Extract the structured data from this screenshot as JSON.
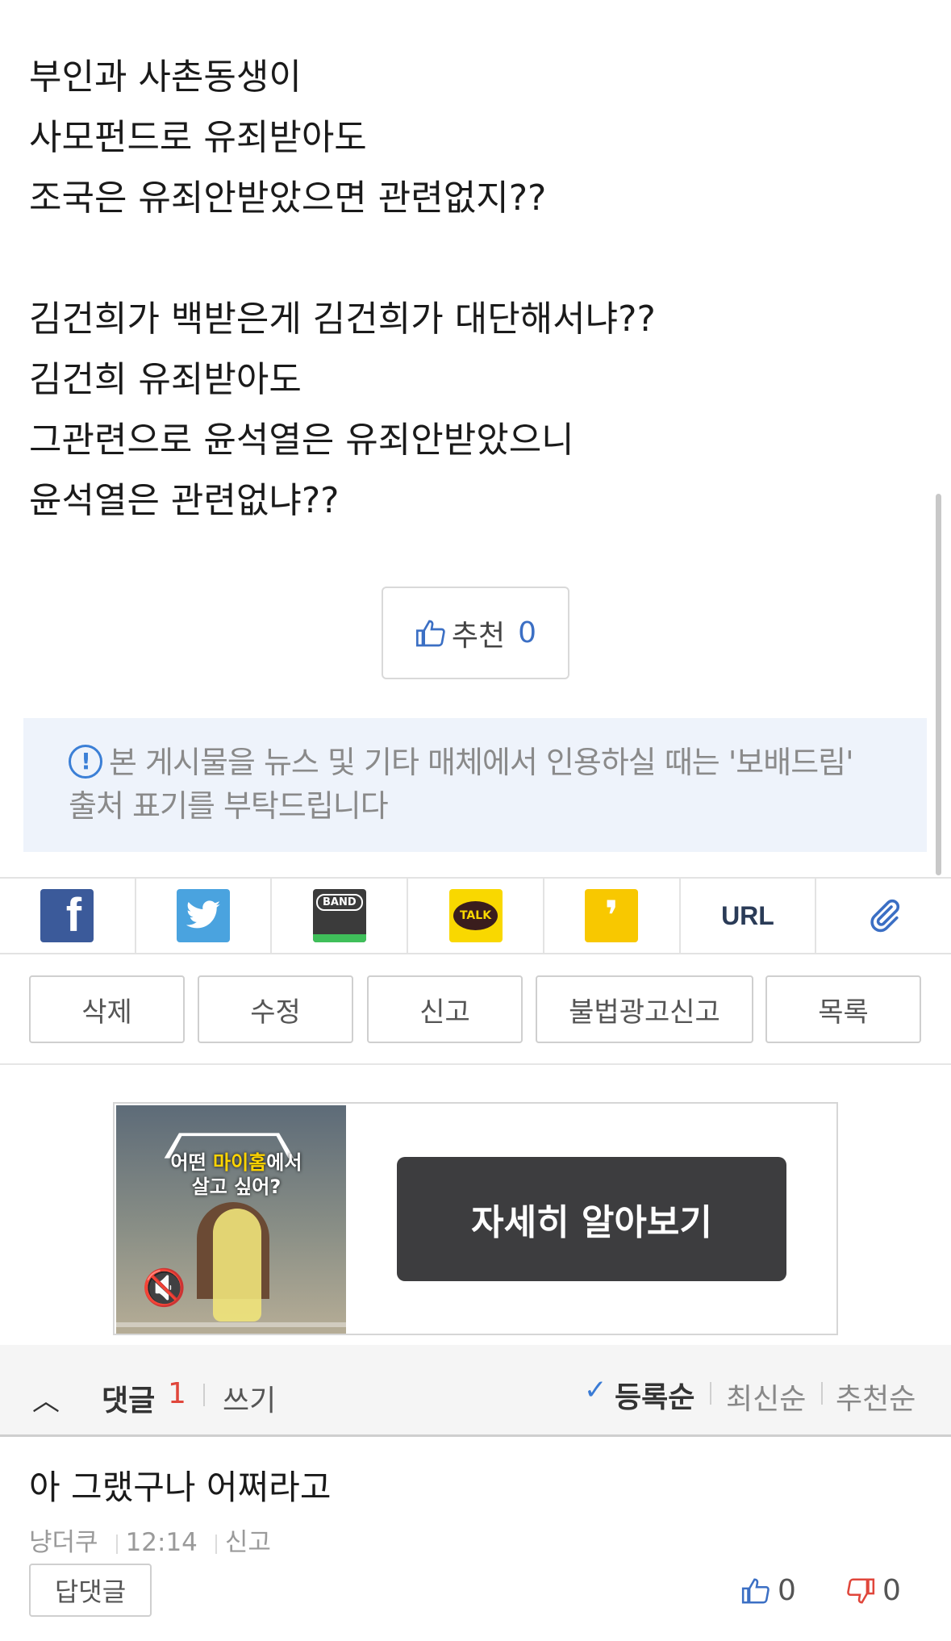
{
  "post": {
    "lines": [
      "부인과 사촌동생이",
      "사모펀드로 유죄받아도",
      "조국은 유죄안받았으면 관련없지??",
      "",
      "김건희가 백받은게 김건희가 대단해서냐??",
      "김건희 유죄받아도",
      "그관련으로 윤석열은 유죄안받았으니",
      "윤석열은 관련없냐??"
    ]
  },
  "recommend": {
    "label": "추천",
    "count": "0"
  },
  "notice": {
    "text": "본 게시물을 뉴스 및 기타 매체에서 인용하실 때는 '보배드림' 출처 표기를 부탁드립니다"
  },
  "share": {
    "facebook": "f",
    "band": "BAND",
    "kakao": "TALK",
    "url": "URL"
  },
  "actions": [
    "삭제",
    "수정",
    "신고",
    "불법광고신고",
    "목록"
  ],
  "ad": {
    "headline_pre": "어떤 ",
    "headline_highlight": "마이홈",
    "headline_post": "에서",
    "headline_line2": "살고 싶어?",
    "cta": "자세히 알아보기"
  },
  "comments_header": {
    "label": "댓글",
    "count": "1",
    "write": "쓰기",
    "sort": [
      "등록순",
      "최신순",
      "추천순"
    ],
    "active_sort": "등록순"
  },
  "comment": {
    "text": "아 그랬구나 어쩌라고",
    "author": "냥더쿠",
    "time": "12:14",
    "report": "신고",
    "reply": "답댓글",
    "likes": "0",
    "dislikes": "0"
  },
  "colors": {
    "accent_blue": "#3b6fc4",
    "comment_count": "#e0463b",
    "notice_bg": "#eef3fb"
  }
}
